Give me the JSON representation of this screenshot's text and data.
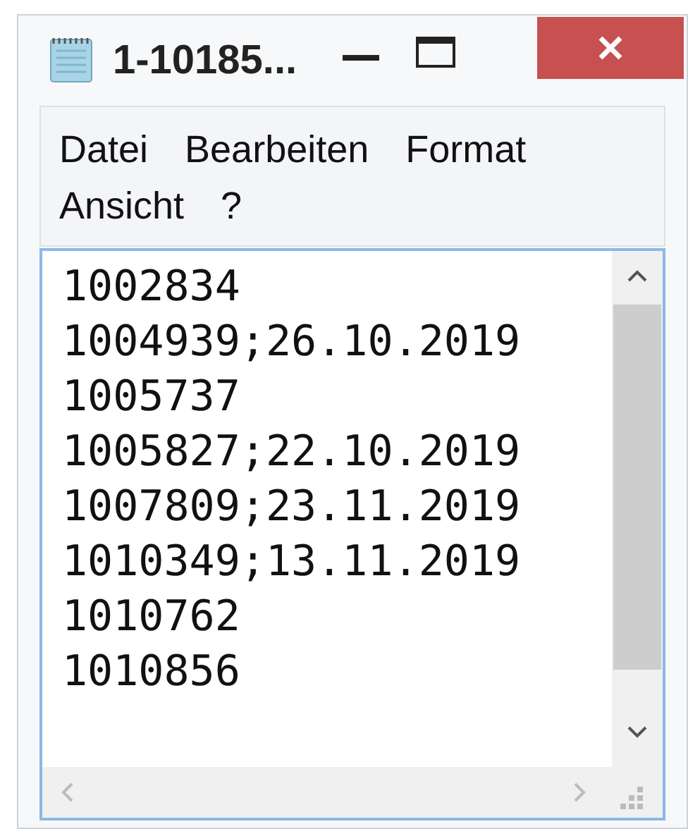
{
  "window": {
    "title": "1-10185..."
  },
  "menu": [
    "Datei",
    "Bearbeiten",
    "Format",
    "Ansicht",
    "?"
  ],
  "editor": {
    "lines": [
      "1002834",
      "1004939;26.10.2019",
      "1005737",
      "1005827;22.10.2019",
      "1007809;23.11.2019",
      "1010349;13.11.2019",
      "1010762",
      "1010856"
    ]
  }
}
